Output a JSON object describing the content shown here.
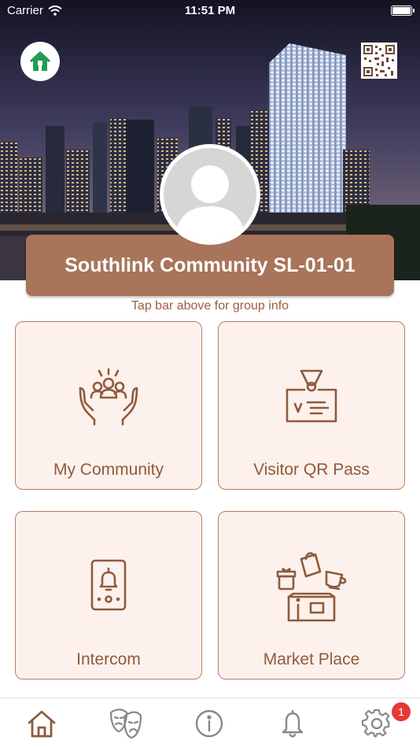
{
  "status_bar": {
    "carrier": "Carrier",
    "time": "11:51 PM"
  },
  "header": {
    "group_title": "Southlink Community SL-01-01",
    "hint": "Tap bar above for group info"
  },
  "tiles": [
    {
      "label": "My Community",
      "icon": "community-hands-icon"
    },
    {
      "label": "Visitor QR Pass",
      "icon": "visitor-badge-icon"
    },
    {
      "label": "Intercom",
      "icon": "intercom-icon"
    },
    {
      "label": "Market Place",
      "icon": "marketplace-icon"
    }
  ],
  "tab_bar": {
    "items": [
      "home-icon",
      "masks-icon",
      "info-icon",
      "bell-icon",
      "settings-icon"
    ],
    "notification_count": "1"
  },
  "colors": {
    "accent": "#a8745a",
    "tile_background": "#fcf1ec",
    "tile_text": "#8f5a3c",
    "home_green": "#1f9d55",
    "badge_red": "#e53935"
  }
}
